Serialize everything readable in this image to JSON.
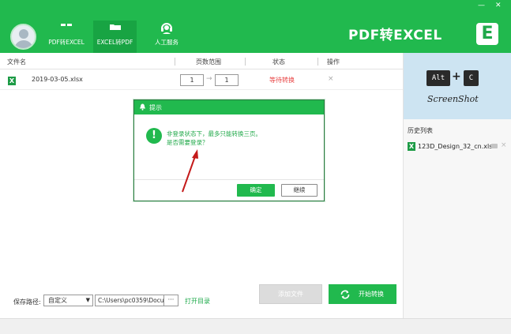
{
  "window": {
    "minimize_label": "—",
    "close_label": "✕"
  },
  "brand": {
    "logo_text": "PDF转EXCEL",
    "logo_letter": "E",
    "color": "#21b94e"
  },
  "nav": {
    "tabs": [
      {
        "label": "PDF转EXCEL",
        "icon": "grid-icon"
      },
      {
        "label": "EXCEL转PDF",
        "icon": "folder-icon",
        "active": true
      },
      {
        "label": "人工服务",
        "icon": "headset-icon"
      }
    ]
  },
  "table": {
    "headers": [
      "文件名",
      "页数范围",
      "状态",
      "操作"
    ],
    "rows": [
      {
        "file_badge": "X",
        "file_name": "2019-03-05.xlsx",
        "page_from": "1",
        "page_to": "1",
        "arrow": "→",
        "status": "等待转换",
        "delete_label": "×"
      }
    ]
  },
  "promo": {
    "key1": "Alt",
    "plus": "+",
    "key2": "C",
    "caption": "ScreenShot"
  },
  "history": {
    "title": "历史列表",
    "items": [
      {
        "badge": "X",
        "file_name": "123D_Design_32_cn.xlsx",
        "close": "×"
      }
    ]
  },
  "footer": {
    "save_label": "保存路径:",
    "save_mode": "自定义",
    "path_value": "C:\\Users\\pc0359\\Docu",
    "browse_label": "···",
    "open_dir": "打开目录",
    "add_file": "添加文件",
    "start_convert": "开始转换"
  },
  "dialog": {
    "title": "提示",
    "icon": "!",
    "message_line1": "非登录状态下，最多只能转换三页。",
    "message_line2": "是否需要登录？",
    "ok_label": "确定",
    "continue_label": "继续"
  }
}
